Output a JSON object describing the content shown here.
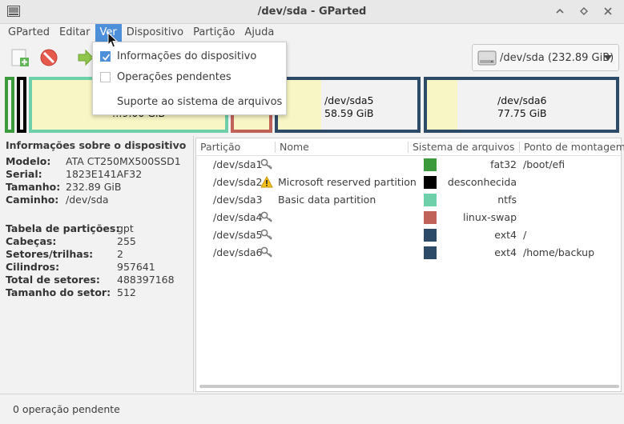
{
  "window": {
    "title": "/dev/sda - GParted"
  },
  "menubar": {
    "items": [
      "GParted",
      "Editar",
      "Ver",
      "Dispositivo",
      "Partição",
      "Ajuda"
    ],
    "active": "Ver"
  },
  "device_select": {
    "value": "/dev/sda  (232.89 GiB)"
  },
  "ver_menu": {
    "items": [
      {
        "label": "Informações do dispositivo",
        "checked": true
      },
      {
        "label": "Operações pendentes",
        "checked": false
      },
      {
        "label": "Suporte ao sistema de arquivos"
      }
    ]
  },
  "diskmap": {
    "partitions": [
      {
        "name": "/dev/sda5",
        "size": "58.59 GiB"
      },
      {
        "name": "/dev/sda6",
        "size": "77.75 GiB"
      }
    ],
    "partial_label": "…9.00 GiB"
  },
  "device_info": {
    "title": "Informações sobre o dispositivo",
    "rows": [
      {
        "k": "Modelo:",
        "v": "ATA CT250MX500SSD1"
      },
      {
        "k": "Serial:",
        "v": "1823E141AF32"
      },
      {
        "k": "Tamanho:",
        "v": "232.89 GiB"
      },
      {
        "k": "Caminho:",
        "v": "/dev/sda"
      }
    ],
    "rows2": [
      {
        "k": "Tabela de partições:",
        "v": "gpt"
      },
      {
        "k": "Cabeças:",
        "v": "255"
      },
      {
        "k": "Setores/trilhas:",
        "v": "2"
      },
      {
        "k": "Cilindros:",
        "v": "957641"
      },
      {
        "k": "Total de setores:",
        "v": "488397168"
      },
      {
        "k": "Tamanho do setor:",
        "v": "512"
      }
    ]
  },
  "partition_table": {
    "columns": [
      "Partição",
      "Nome",
      "Sistema de arquivos",
      "Ponto de montagem"
    ],
    "rows": [
      {
        "partition": "/dev/sda1",
        "icon": "key-icon",
        "name": "",
        "fs": "fat32",
        "fs_color": "#3a9a3c",
        "mount": "/boot/efi"
      },
      {
        "partition": "/dev/sda2",
        "icon": "warning-icon",
        "name": "Microsoft reserved partition",
        "fs": "desconhecida",
        "fs_color": "#000000",
        "mount": ""
      },
      {
        "partition": "/dev/sda3",
        "icon": "",
        "name": "Basic data partition",
        "fs": "ntfs",
        "fs_color": "#6dd0aa",
        "mount": ""
      },
      {
        "partition": "/dev/sda4",
        "icon": "key-icon",
        "name": "",
        "fs": "linux-swap",
        "fs_color": "#c06258",
        "mount": ""
      },
      {
        "partition": "/dev/sda5",
        "icon": "key-icon",
        "name": "",
        "fs": "ext4",
        "fs_color": "#2d4a66",
        "mount": "/"
      },
      {
        "partition": "/dev/sda6",
        "icon": "key-icon",
        "name": "",
        "fs": "ext4",
        "fs_color": "#2d4a66",
        "mount": "/home/backup"
      }
    ]
  },
  "statusbar": {
    "text": "0 operação pendente"
  }
}
